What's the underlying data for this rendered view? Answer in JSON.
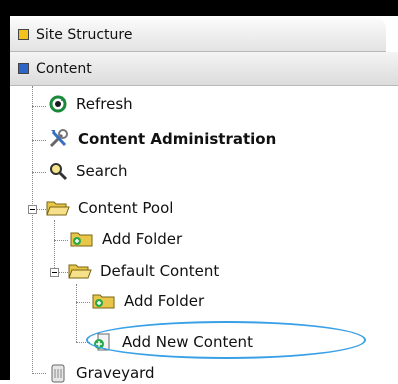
{
  "tabs": {
    "site_structure": "Site Structure",
    "content": "Content"
  },
  "tree": {
    "refresh": "Refresh",
    "content_administration": "Content Administration",
    "search": "Search",
    "content_pool": "Content Pool",
    "content_pool_add_folder": "Add Folder",
    "default_content": "Default Content",
    "default_content_add_folder": "Add Folder",
    "add_new_content": "Add New Content",
    "graveyard": "Graveyard"
  },
  "colors": {
    "site_structure_square": "#f4c21c",
    "content_square": "#2d66c6",
    "highlight": "#3aa0e6"
  }
}
